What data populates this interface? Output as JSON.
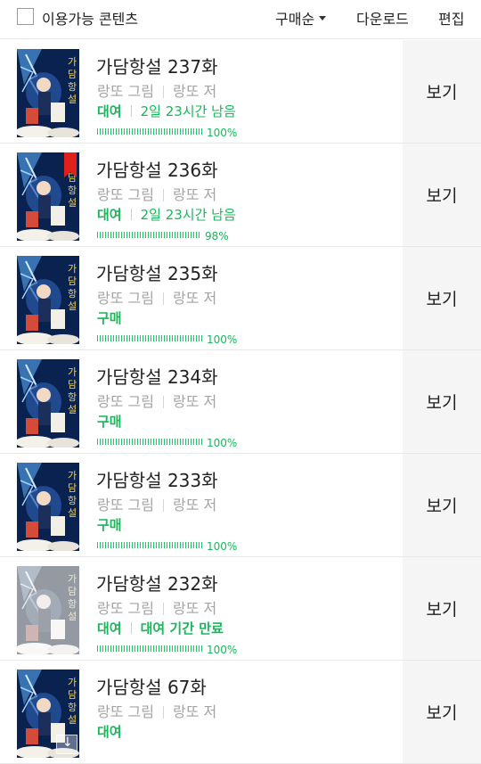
{
  "header": {
    "filter_label": "이용가능 콘텐츠",
    "sort_label": "구매순",
    "download_label": "다운로드",
    "edit_label": "편집"
  },
  "colors": {
    "accent_green": "#16b85a",
    "bookmark_red": "#e0201a",
    "view_bg": "#f5f5f5"
  },
  "episodes": [
    {
      "title": "가담항설 237화",
      "illustrator": "랑또 그림",
      "author": "랑또 저",
      "type": "대여",
      "remaining": "2일 23시간 남음",
      "progress_label": "100%",
      "progress": 1.0,
      "view_label": "보기"
    },
    {
      "title": "가담항설 236화",
      "illustrator": "랑또 그림",
      "author": "랑또 저",
      "type": "대여",
      "remaining": "2일 23시간 남음",
      "progress_label": "98%",
      "progress": 0.98,
      "view_label": "보기"
    },
    {
      "title": "가담항설 235화",
      "illustrator": "랑또 그림",
      "author": "랑또 저",
      "type": "구매",
      "progress_label": "100%",
      "progress": 1.0,
      "view_label": "보기"
    },
    {
      "title": "가담항설 234화",
      "illustrator": "랑또 그림",
      "author": "랑또 저",
      "type": "구매",
      "progress_label": "100%",
      "progress": 1.0,
      "view_label": "보기"
    },
    {
      "title": "가담항설 233화",
      "illustrator": "랑또 그림",
      "author": "랑또 저",
      "type": "구매",
      "progress_label": "100%",
      "progress": 1.0,
      "view_label": "보기"
    },
    {
      "title": "가담항설 232화",
      "illustrator": "랑또 그림",
      "author": "랑또 저",
      "type": "대여",
      "remaining": "대여 기간 만료",
      "progress_label": "100%",
      "progress": 1.0,
      "view_label": "보기"
    },
    {
      "title": "가담항설 67화",
      "illustrator": "랑또 그림",
      "author": "랑또 저",
      "type": "대여",
      "view_label": "보기"
    }
  ]
}
